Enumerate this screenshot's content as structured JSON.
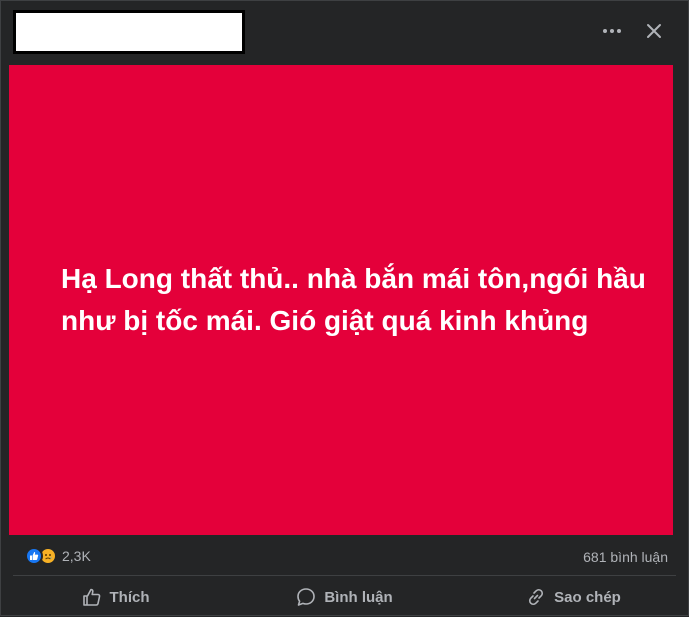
{
  "header": {
    "more_icon": "more-horizontal-icon",
    "close_icon": "close-icon"
  },
  "post": {
    "background_color": "#e4003a",
    "text": "Hạ Long thất thủ.. nhà bắn mái tôn,ngói hầu như bị tốc mái. Gió giật quá kinh khủng"
  },
  "stats": {
    "reaction_icons": [
      "like-icon",
      "sad-icon"
    ],
    "reaction_count": "2,3K",
    "comment_count": "681 bình luận"
  },
  "actions": {
    "like_label": "Thích",
    "comment_label": "Bình luận",
    "copy_label": "Sao chép"
  }
}
